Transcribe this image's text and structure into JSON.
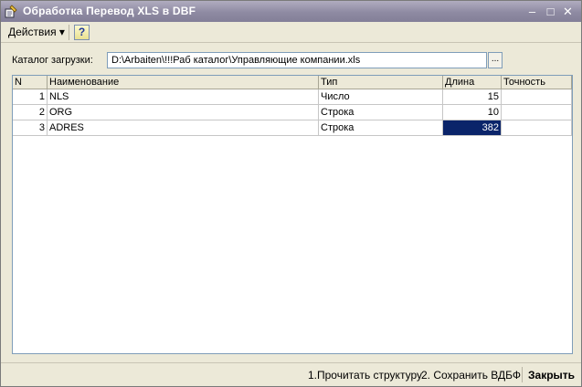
{
  "window": {
    "title": "Обработка  Перевод XLS в DBF",
    "controls": {
      "minimize": "–",
      "maximize": "□",
      "close": "✕"
    }
  },
  "toolbar": {
    "actions_label": "Действия ▾",
    "help_label": "?"
  },
  "form": {
    "path_label": "Каталог загрузки:",
    "path_value": "D:\\Arbaiten\\!!!Раб каталог\\Управляющие компании.xls",
    "browse_label": "..."
  },
  "table": {
    "columns": {
      "n": "N",
      "name": "Наименование",
      "type": "Тип",
      "length": "Длина",
      "precision": "Точность"
    },
    "rows": [
      {
        "n": "1",
        "name": "NLS",
        "type": "Число",
        "length": "15",
        "precision": ""
      },
      {
        "n": "2",
        "name": "ORG",
        "type": "Строка",
        "length": "10",
        "precision": ""
      },
      {
        "n": "3",
        "name": "ADRES",
        "type": "Строка",
        "length": "382",
        "precision": ""
      }
    ]
  },
  "footer": {
    "read_structure": "1.Прочитать структуру",
    "save_dbf": "2. Сохранить ВДБФ",
    "close": "Закрыть"
  }
}
